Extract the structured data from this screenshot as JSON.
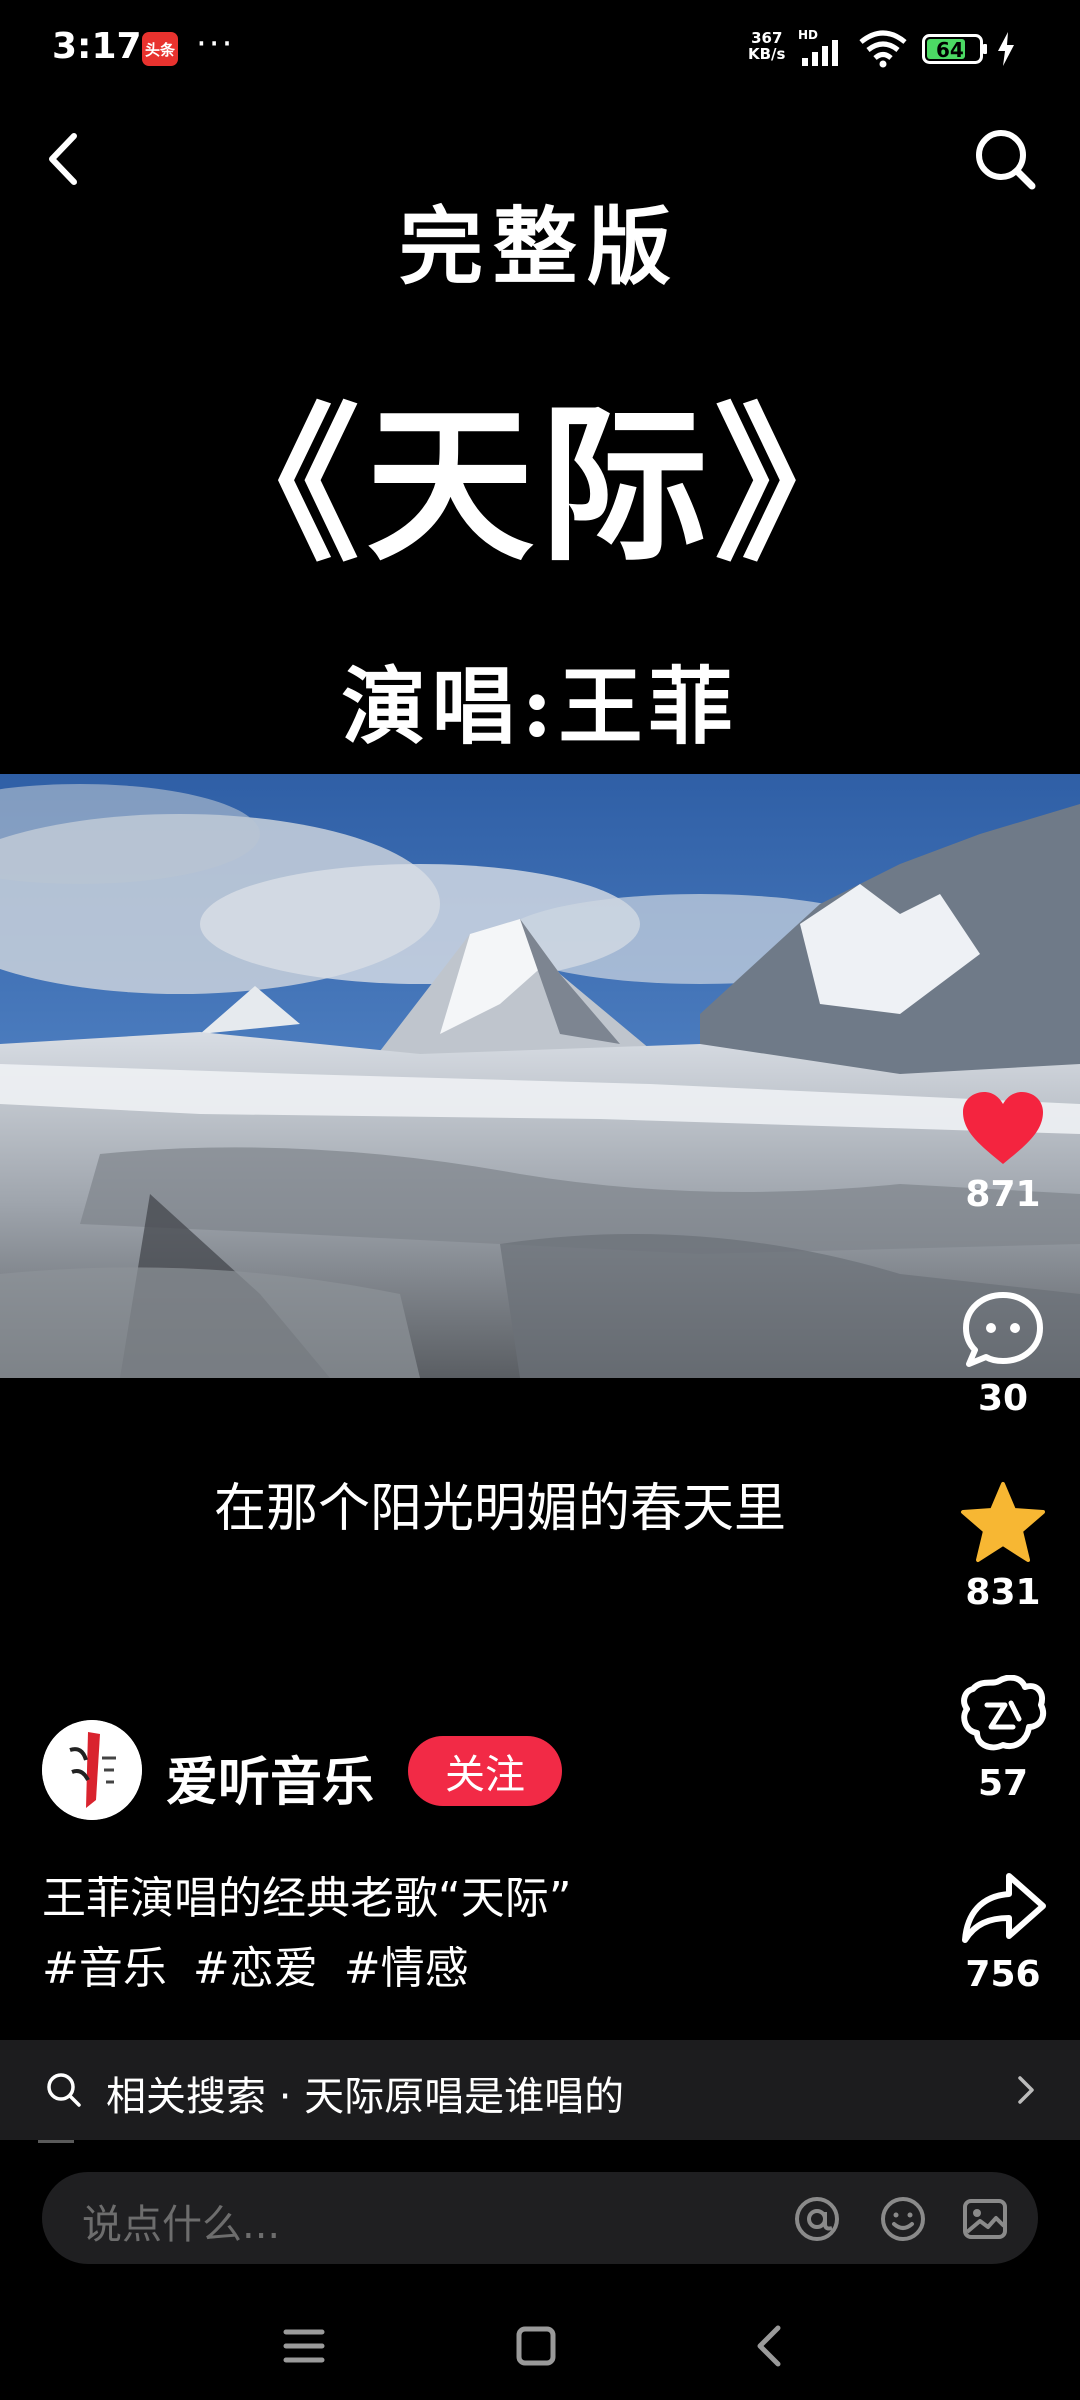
{
  "status_bar": {
    "time": "3:17",
    "app_badge": "头条",
    "more": "···",
    "net_speed_value": "367",
    "net_speed_unit": "KB/s",
    "network_type": "HD",
    "battery": "64"
  },
  "video": {
    "title_top": "完整版",
    "title_main": "《天际》",
    "title_singer": "演唱:王菲",
    "subtitle": "在那个阳光明媚的春天里"
  },
  "actions": {
    "like_count": "871",
    "comment_count": "30",
    "favorite_count": "831",
    "gift_count": "57",
    "share_count": "756"
  },
  "author": {
    "name": "爱听音乐",
    "follow_label": "关注"
  },
  "post": {
    "description": "王菲演唱的经典老歌“天际”",
    "tags": [
      "#音乐",
      "#恋爱",
      "#情感"
    ]
  },
  "related_search": {
    "text": "相关搜索 · 天际原唱是谁唱的"
  },
  "comment_input": {
    "placeholder": "说点什么..."
  },
  "colors": {
    "like": "#f4243f",
    "favorite": "#f7b733",
    "follow": "#f22a46"
  }
}
